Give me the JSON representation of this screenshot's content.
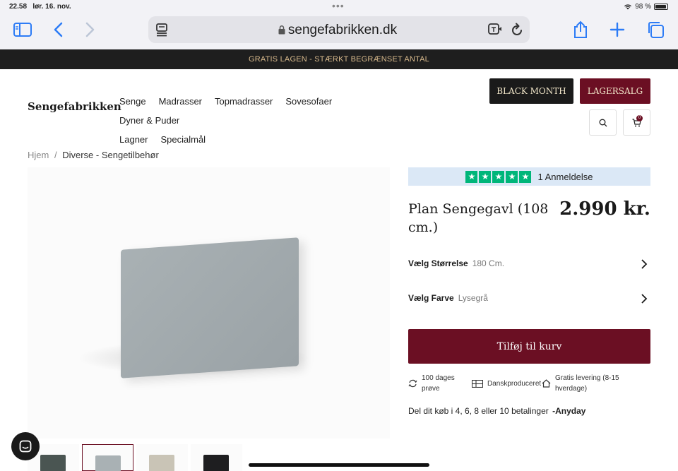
{
  "status": {
    "time": "22.58",
    "date": "lør. 16. nov.",
    "battery": "98 %",
    "battery_level": 0.98
  },
  "browser": {
    "url": "sengefabrikken.dk"
  },
  "promo": {
    "text": "GRATIS LAGEN - STÆRKT BEGRÆNSET ANTAL"
  },
  "header": {
    "logo": "Sengefabrikken",
    "nav": [
      "Senge",
      "Madrasser",
      "Topmadrasser",
      "Sovesofaer",
      "Dyner & Puder",
      "Lagner",
      "Specialmål"
    ],
    "black_month": "BLACK MONTH",
    "lagersalg": "LAGERSALG",
    "cart_count": "0"
  },
  "breadcrumb": {
    "home": "Hjem",
    "sep": "/",
    "current": "Diverse - Sengetilbehør"
  },
  "product": {
    "reviews": "1 Anmeldelse",
    "rating": 5,
    "title": "Plan Sengegavl (108 cm.)",
    "price": "2.990 kr.",
    "size_label": "Vælg Størrelse",
    "size_value": "180 Cm.",
    "color_label": "Vælg Farve",
    "color_value": "Lysegrå",
    "add_to_cart": "Tilføj til kurv",
    "usp1": "100 dages prøve",
    "usp2": "Danskproduceret",
    "usp3": "Gratis levering (8-15 hverdage)",
    "anyday_text": "Del dit køb i 4, 6, 8 eller 10 betalinger",
    "anyday_brand": "Anyday"
  },
  "thumb_colors": [
    "#4a5552",
    "#a9b1b4",
    "#c9c4b6",
    "#1e1e20"
  ],
  "colors": {
    "accent": "#6b0f23",
    "dark": "#1a1a1a",
    "trustpilot": "#00b67a",
    "link_blue": "#2d7cf6"
  }
}
